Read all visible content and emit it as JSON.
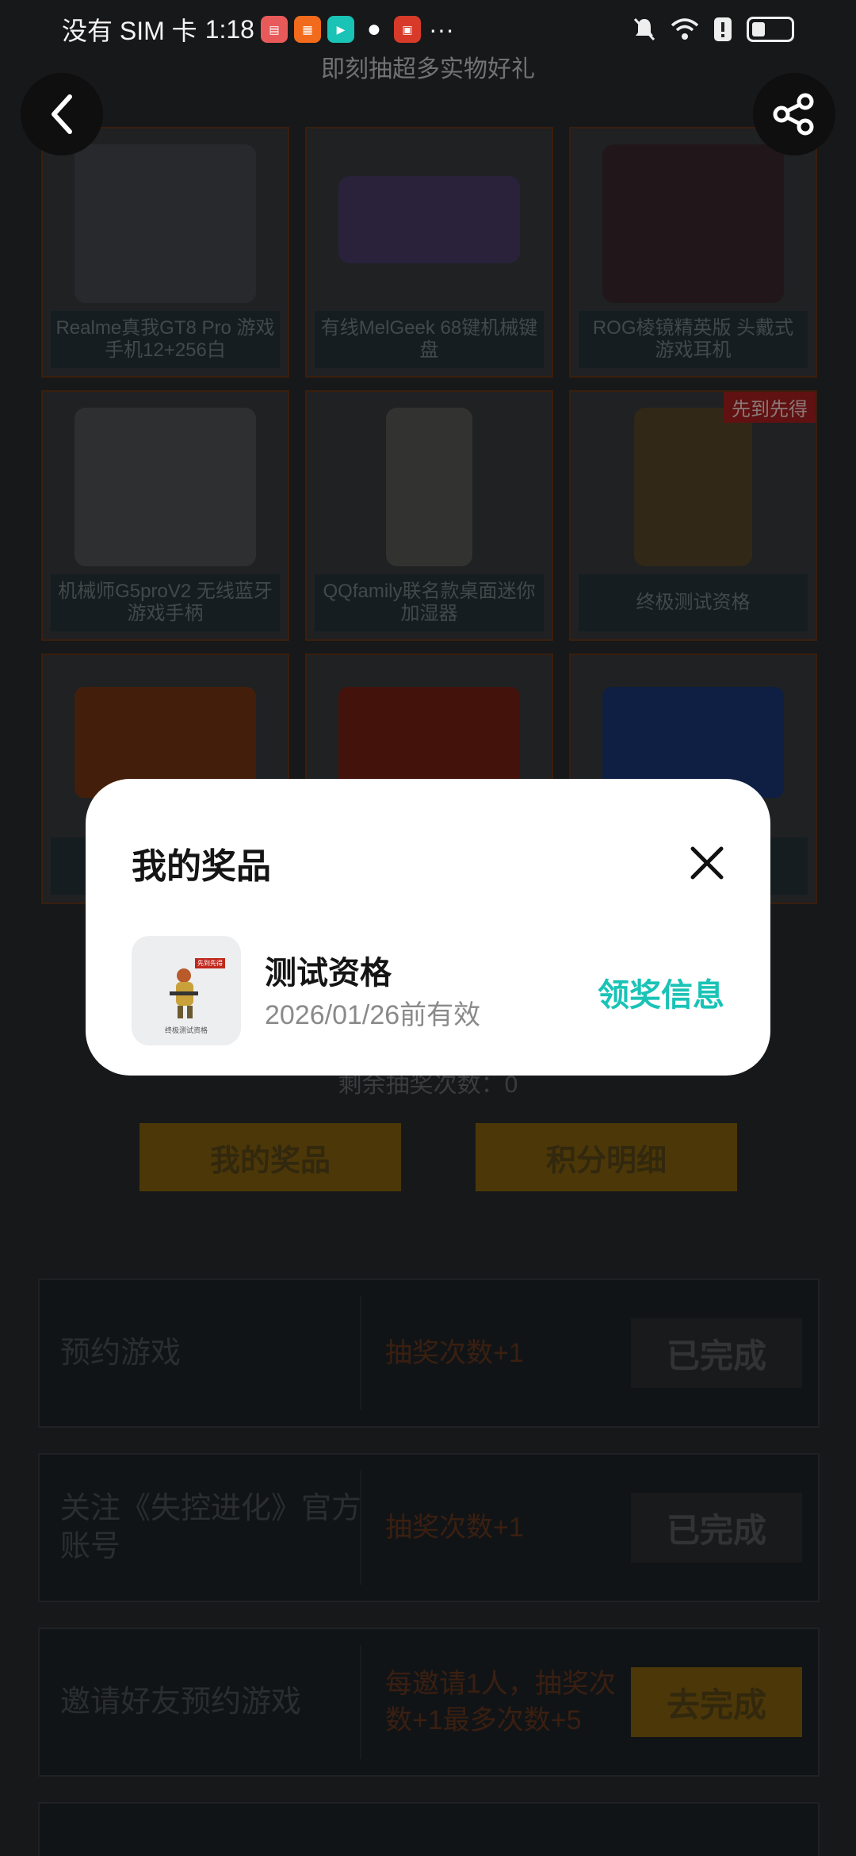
{
  "status_bar": {
    "carrier": "没有 SIM 卡",
    "time": "1:18",
    "more": "···"
  },
  "page": {
    "banner_subtitle": "即刻抽超多实物好礼",
    "remaining_draws": "剩余抽奖次数：0",
    "my_prizes_button": "我的奖品",
    "points_detail_button": "积分明细",
    "prizes": [
      {
        "label": "Realme真我GT8 Pro 游戏手机12+256白"
      },
      {
        "label": "有线MelGeek 68键机械键盘"
      },
      {
        "label": "ROG棱镜精英版 头戴式游戏耳机"
      },
      {
        "label": "机械师G5proV2 无线蓝牙游戏手柄"
      },
      {
        "label": "QQfamily联名款桌面迷你加湿器"
      },
      {
        "label": "终极测试资格",
        "badge": "先到先得"
      },
      {
        "label": ""
      },
      {
        "label": ""
      },
      {
        "label": ""
      }
    ],
    "tasks": [
      {
        "name": "预约游戏",
        "reward": "抽奖次数+1",
        "action": "已完成",
        "active": false
      },
      {
        "name": "关注《失控进化》官方账号",
        "reward": "抽奖次数+1",
        "action": "已完成",
        "active": false
      },
      {
        "name": "邀请好友预约游戏",
        "reward": "每邀请1人，抽奖次数+1最多次数+5",
        "action": "去完成",
        "active": true
      }
    ]
  },
  "dialog": {
    "title": "我的奖品",
    "prize": {
      "name": "测试资格",
      "validity": "2026/01/26前有效",
      "thumb_caption": "终极测试资格",
      "thumb_tag": "先到先得"
    },
    "claim_label": "领奖信息"
  },
  "colors": {
    "accent_teal": "#19c3b6",
    "dialog_bg": "#ffffff"
  }
}
